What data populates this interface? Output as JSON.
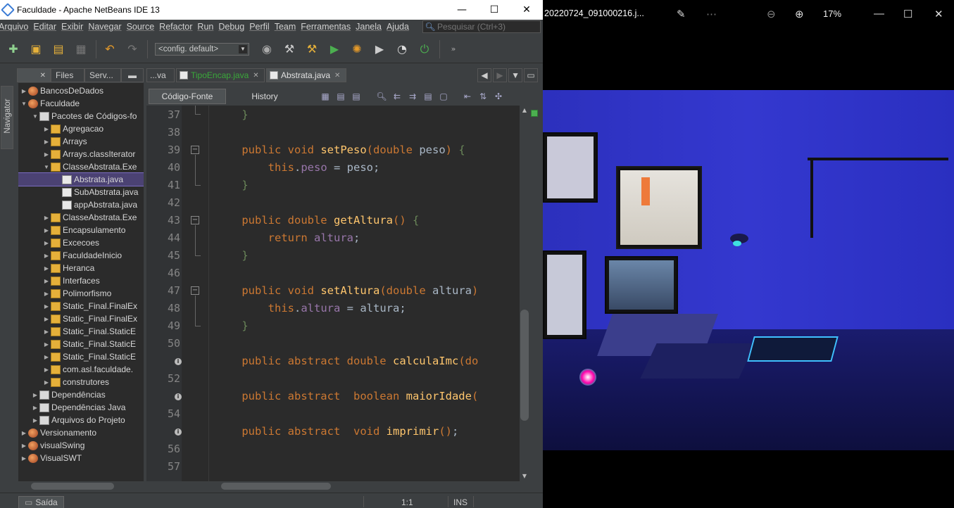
{
  "window": {
    "title": "Faculdade - Apache NetBeans IDE 13",
    "minimize": "—",
    "maximize": "☐",
    "close": "✕"
  },
  "menu": [
    "Arquivo",
    "Editar",
    "Exibir",
    "Navegar",
    "Source",
    "Refactor",
    "Run",
    "Debug",
    "Perfil",
    "Team",
    "Ferramentas",
    "Janela",
    "Ajuda"
  ],
  "search": {
    "placeholder": "Pesquisar (Ctrl+3)"
  },
  "toolbar": {
    "config": "<config. default>"
  },
  "navigator": {
    "label": "Navigator"
  },
  "panel_tabs": [
    {
      "label": ""
    },
    {
      "label": "Files"
    },
    {
      "label": "Serv..."
    }
  ],
  "tree": [
    {
      "label": "BancosDeDados",
      "level": 0,
      "toggle": "▶",
      "icon": "prj"
    },
    {
      "label": "Faculdade",
      "level": 0,
      "toggle": "▼",
      "icon": "prj"
    },
    {
      "label": "Pacotes de Códigos-fo",
      "level": 1,
      "toggle": "▼",
      "icon": "fld"
    },
    {
      "label": "Agregacao",
      "level": 2,
      "toggle": "▶",
      "icon": "pkg"
    },
    {
      "label": "Arrays",
      "level": 2,
      "toggle": "▶",
      "icon": "pkg"
    },
    {
      "label": "Arrays.classIterator",
      "level": 2,
      "toggle": "▶",
      "icon": "pkg"
    },
    {
      "label": "ClasseAbstrata.Exe",
      "level": 2,
      "toggle": "▼",
      "icon": "pkg"
    },
    {
      "label": "Abstrata.java",
      "level": 3,
      "toggle": "",
      "icon": "jf",
      "selected": true
    },
    {
      "label": "SubAbstrata.java",
      "level": 3,
      "toggle": "",
      "icon": "jf"
    },
    {
      "label": "appAbstrata.java",
      "level": 3,
      "toggle": "",
      "icon": "jf"
    },
    {
      "label": "ClasseAbstrata.Exe",
      "level": 2,
      "toggle": "▶",
      "icon": "pkg"
    },
    {
      "label": "Encapsulamento",
      "level": 2,
      "toggle": "▶",
      "icon": "pkg"
    },
    {
      "label": "Excecoes",
      "level": 2,
      "toggle": "▶",
      "icon": "pkg"
    },
    {
      "label": "FaculdadeInicio",
      "level": 2,
      "toggle": "▶",
      "icon": "pkg"
    },
    {
      "label": "Heranca",
      "level": 2,
      "toggle": "▶",
      "icon": "pkg"
    },
    {
      "label": "Interfaces",
      "level": 2,
      "toggle": "▶",
      "icon": "pkg"
    },
    {
      "label": "Polimorfismo",
      "level": 2,
      "toggle": "▶",
      "icon": "pkg"
    },
    {
      "label": "Static_Final.FinalEx",
      "level": 2,
      "toggle": "▶",
      "icon": "pkg"
    },
    {
      "label": "Static_Final.FinalEx",
      "level": 2,
      "toggle": "▶",
      "icon": "pkg"
    },
    {
      "label": "Static_Final.StaticE",
      "level": 2,
      "toggle": "▶",
      "icon": "pkg"
    },
    {
      "label": "Static_Final.StaticE",
      "level": 2,
      "toggle": "▶",
      "icon": "pkg"
    },
    {
      "label": "Static_Final.StaticE",
      "level": 2,
      "toggle": "▶",
      "icon": "pkg"
    },
    {
      "label": "com.asl.faculdade.",
      "level": 2,
      "toggle": "▶",
      "icon": "pkg"
    },
    {
      "label": "construtores",
      "level": 2,
      "toggle": "▶",
      "icon": "pkg"
    },
    {
      "label": "Dependências",
      "level": 1,
      "toggle": "▶",
      "icon": "fld"
    },
    {
      "label": "Dependências Java",
      "level": 1,
      "toggle": "▶",
      "icon": "fld"
    },
    {
      "label": "Arquivos do Projeto",
      "level": 1,
      "toggle": "▶",
      "icon": "fld"
    },
    {
      "label": "Versionamento",
      "level": 0,
      "toggle": "▶",
      "icon": "prj"
    },
    {
      "label": "visualSwing",
      "level": 0,
      "toggle": "▶",
      "icon": "prj"
    },
    {
      "label": "VisualSWT",
      "level": 0,
      "toggle": "▶",
      "icon": "prj"
    }
  ],
  "editor_tabs": [
    {
      "label": "...va",
      "active": false,
      "green": false
    },
    {
      "label": "TipoEncap.java",
      "active": false,
      "green": true
    },
    {
      "label": "Abstrata.java",
      "active": true,
      "green": false
    }
  ],
  "editor_subtabs": {
    "source": "Código-Fonte",
    "history": "History"
  },
  "code_lines": [
    {
      "n": "37",
      "html": "    <span class='br'>}</span>"
    },
    {
      "n": "38",
      "html": ""
    },
    {
      "n": "39",
      "html": "    <span class='kw'>public void</span> <span class='fn'>setPeso</span><span class='kw'>(</span><span class='kw'>double</span> <span class='pr'>peso</span><span class='kw'>)</span> <span class='br'>{</span>",
      "fold": true
    },
    {
      "n": "40",
      "html": "        <span class='kw'>this</span>.<span class='fld'>peso</span> = <span class='pr'>peso</span>;"
    },
    {
      "n": "41",
      "html": "    <span class='br'>}</span>"
    },
    {
      "n": "42",
      "html": ""
    },
    {
      "n": "43",
      "html": "    <span class='kw'>public double</span> <span class='fn'>getAltura</span><span class='kw'>()</span> <span class='br'>{</span>",
      "fold": true
    },
    {
      "n": "44",
      "html": "        <span class='kw'>return</span> <span class='fld'>altura</span>;"
    },
    {
      "n": "45",
      "html": "    <span class='br'>}</span>"
    },
    {
      "n": "46",
      "html": ""
    },
    {
      "n": "47",
      "html": "    <span class='kw'>public void</span> <span class='fn'>setAltura</span><span class='kw'>(</span><span class='kw'>double</span> <span class='pr'>altura</span><span class='kw'>)</span>",
      "fold": true
    },
    {
      "n": "48",
      "html": "        <span class='kw'>this</span>.<span class='fld'>altura</span> = <span class='pr'>altura</span>;"
    },
    {
      "n": "49",
      "html": "    <span class='br'>}</span>"
    },
    {
      "n": "50",
      "html": ""
    },
    {
      "n": "",
      "html": "    <span class='kw'>public abstract double</span> <span class='fn'>calculaImc</span><span class='kw'>(do</span>",
      "marker": true
    },
    {
      "n": "52",
      "html": ""
    },
    {
      "n": "",
      "html": "    <span class='kw'>public abstract</span>  <span class='kw'>boolean</span> <span class='fn'>maiorIdade</span><span class='kw'>(</span>",
      "marker": true
    },
    {
      "n": "54",
      "html": ""
    },
    {
      "n": "",
      "html": "    <span class='kw'>public abstract</span>  <span class='kw'>void</span> <span class='fn'>imprimir</span><span class='kw'>()</span>;",
      "marker": true
    },
    {
      "n": "56",
      "html": ""
    },
    {
      "n": "57",
      "html": ""
    }
  ],
  "status": {
    "output": "Saída",
    "position": "1:1",
    "mode": "INS"
  },
  "photo_viewer": {
    "filename": "20220724_091000216.j...",
    "zoom": "17%",
    "icons": [
      "edit-icon",
      "zoom-out-icon",
      "zoom-in-icon"
    ]
  }
}
